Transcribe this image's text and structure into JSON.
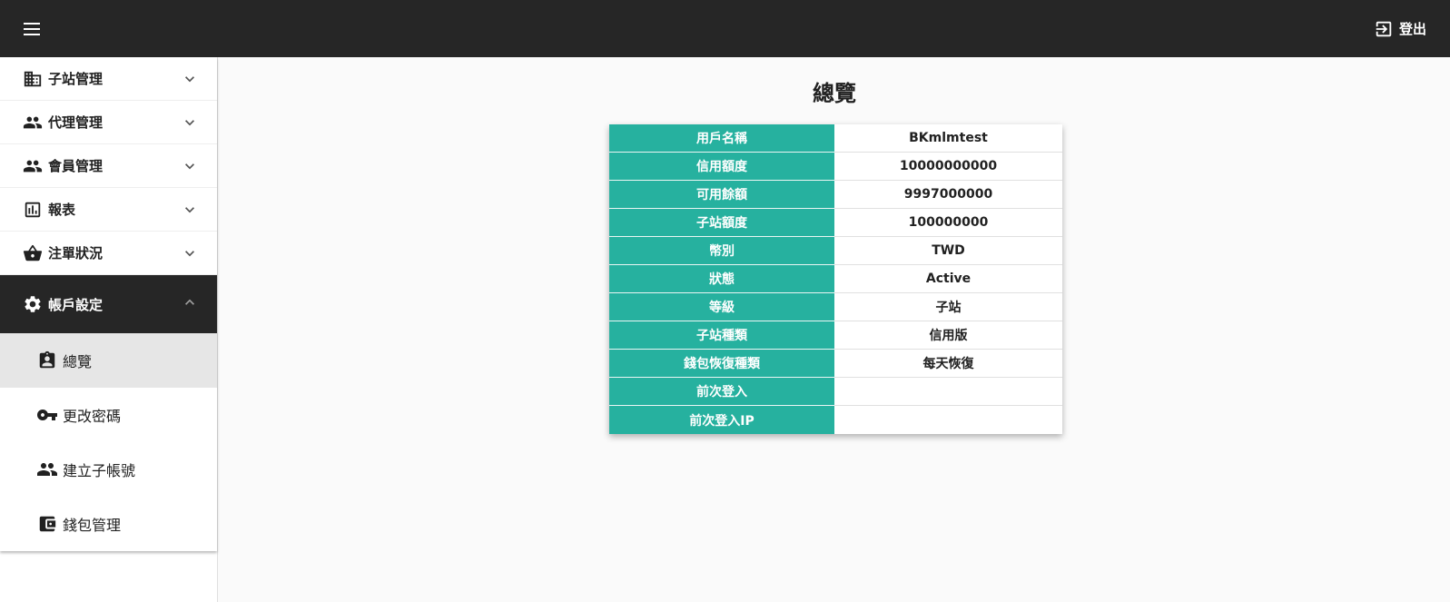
{
  "header": {
    "menu_icon": "hamburger-menu-icon",
    "logout_label": "登出",
    "logout_icon": "logout-icon"
  },
  "sidebar": {
    "items": [
      {
        "label": "子站管理",
        "icon": "domain-icon",
        "expanded": false
      },
      {
        "label": "代理管理",
        "icon": "people-icon",
        "expanded": false
      },
      {
        "label": "會員管理",
        "icon": "people-icon",
        "expanded": false
      },
      {
        "label": "報表",
        "icon": "bar-chart-icon",
        "expanded": false
      },
      {
        "label": "注單狀況",
        "icon": "basket-icon",
        "expanded": false
      },
      {
        "label": "帳戶設定",
        "icon": "gear-icon",
        "expanded": true
      }
    ],
    "sub_items": [
      {
        "label": "總覽",
        "icon": "account-badge-icon",
        "active": true
      },
      {
        "label": "更改密碼",
        "icon": "key-icon",
        "active": false
      },
      {
        "label": "建立子帳號",
        "icon": "people-icon",
        "active": false
      },
      {
        "label": "錢包管理",
        "icon": "wallet-icon",
        "active": false
      }
    ]
  },
  "main": {
    "title": "總覽",
    "rows": [
      {
        "key": "用戶名稱",
        "value": "BKmlmtest"
      },
      {
        "key": "信用額度",
        "value": "10000000000"
      },
      {
        "key": "可用餘額",
        "value": "9997000000"
      },
      {
        "key": "子站額度",
        "value": "100000000"
      },
      {
        "key": "幣別",
        "value": "TWD"
      },
      {
        "key": "狀態",
        "value": "Active"
      },
      {
        "key": "等級",
        "value": "子站"
      },
      {
        "key": "子站種類",
        "value": "信用版"
      },
      {
        "key": "錢包恢復種類",
        "value": "每天恢復"
      },
      {
        "key": "前次登入",
        "value": ""
      },
      {
        "key": "前次登入IP",
        "value": ""
      }
    ]
  },
  "colors": {
    "topbar": "#262626",
    "accent_teal": "#26b19f",
    "active_sub": "#e6e6e6"
  }
}
